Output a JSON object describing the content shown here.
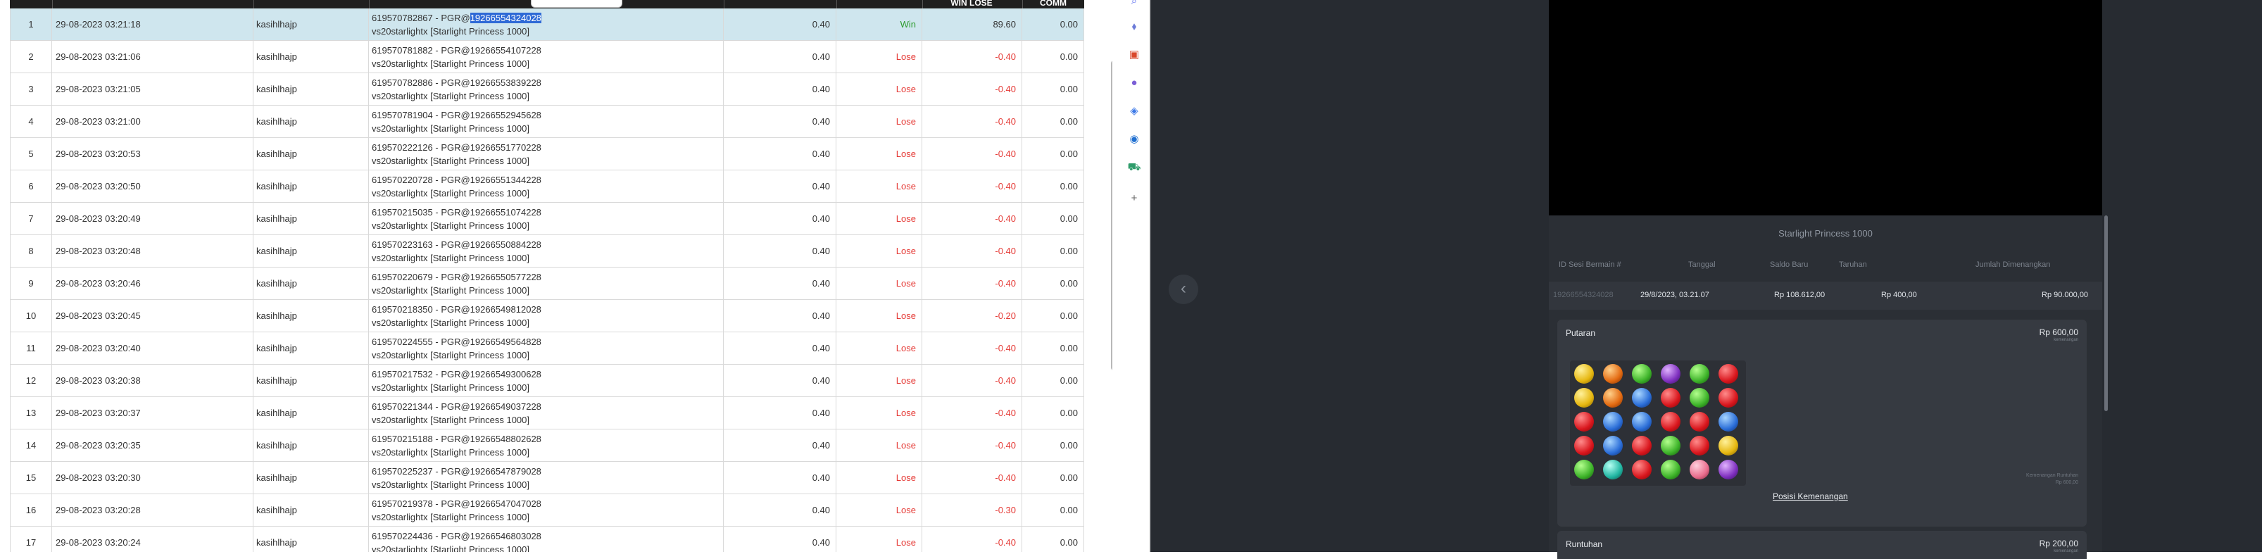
{
  "table": {
    "header": {
      "winlose": "WIN LOSE",
      "comm": "COMM"
    },
    "rows": [
      {
        "no": "1",
        "date": "29-08-2023 03:21:18",
        "user": "kasihlhajp",
        "ref_a": "619570782867 - PGR@",
        "ref_sel": "19266554324028",
        "line2": "vs20starlightx [Starlight Princess 1000]",
        "bet": "0.40",
        "status": "Win",
        "winlose": "89.60",
        "comm": "0.00"
      },
      {
        "no": "2",
        "date": "29-08-2023 03:21:06",
        "user": "kasihlhajp",
        "ref_a": "619570781882 - PGR@19266554107228",
        "ref_sel": "",
        "line2": "vs20starlightx [Starlight Princess 1000]",
        "bet": "0.40",
        "status": "Lose",
        "winlose": "-0.40",
        "comm": "0.00"
      },
      {
        "no": "3",
        "date": "29-08-2023 03:21:05",
        "user": "kasihlhajp",
        "ref_a": "619570782886 - PGR@19266553839228",
        "ref_sel": "",
        "line2": "vs20starlightx [Starlight Princess 1000]",
        "bet": "0.40",
        "status": "Lose",
        "winlose": "-0.40",
        "comm": "0.00"
      },
      {
        "no": "4",
        "date": "29-08-2023 03:21:00",
        "user": "kasihlhajp",
        "ref_a": "619570781904 - PGR@19266552945628",
        "ref_sel": "",
        "line2": "vs20starlightx [Starlight Princess 1000]",
        "bet": "0.40",
        "status": "Lose",
        "winlose": "-0.40",
        "comm": "0.00"
      },
      {
        "no": "5",
        "date": "29-08-2023 03:20:53",
        "user": "kasihlhajp",
        "ref_a": "619570222126 - PGR@19266551770228",
        "ref_sel": "",
        "line2": "vs20starlightx [Starlight Princess 1000]",
        "bet": "0.40",
        "status": "Lose",
        "winlose": "-0.40",
        "comm": "0.00"
      },
      {
        "no": "6",
        "date": "29-08-2023 03:20:50",
        "user": "kasihlhajp",
        "ref_a": "619570220728 - PGR@19266551344228",
        "ref_sel": "",
        "line2": "vs20starlightx [Starlight Princess 1000]",
        "bet": "0.40",
        "status": "Lose",
        "winlose": "-0.40",
        "comm": "0.00"
      },
      {
        "no": "7",
        "date": "29-08-2023 03:20:49",
        "user": "kasihlhajp",
        "ref_a": "619570215035 - PGR@19266551074228",
        "ref_sel": "",
        "line2": "vs20starlightx [Starlight Princess 1000]",
        "bet": "0.40",
        "status": "Lose",
        "winlose": "-0.40",
        "comm": "0.00"
      },
      {
        "no": "8",
        "date": "29-08-2023 03:20:48",
        "user": "kasihlhajp",
        "ref_a": "619570223163 - PGR@19266550884228",
        "ref_sel": "",
        "line2": "vs20starlightx [Starlight Princess 1000]",
        "bet": "0.40",
        "status": "Lose",
        "winlose": "-0.40",
        "comm": "0.00"
      },
      {
        "no": "9",
        "date": "29-08-2023 03:20:46",
        "user": "kasihlhajp",
        "ref_a": "619570220679 - PGR@19266550577228",
        "ref_sel": "",
        "line2": "vs20starlightx [Starlight Princess 1000]",
        "bet": "0.40",
        "status": "Lose",
        "winlose": "-0.40",
        "comm": "0.00"
      },
      {
        "no": "10",
        "date": "29-08-2023 03:20:45",
        "user": "kasihlhajp",
        "ref_a": "619570218350 - PGR@19266549812028",
        "ref_sel": "",
        "line2": "vs20starlightx [Starlight Princess 1000]",
        "bet": "0.40",
        "status": "Lose",
        "winlose": "-0.20",
        "comm": "0.00"
      },
      {
        "no": "11",
        "date": "29-08-2023 03:20:40",
        "user": "kasihlhajp",
        "ref_a": "619570224555 - PGR@19266549564828",
        "ref_sel": "",
        "line2": "vs20starlightx [Starlight Princess 1000]",
        "bet": "0.40",
        "status": "Lose",
        "winlose": "-0.40",
        "comm": "0.00"
      },
      {
        "no": "12",
        "date": "29-08-2023 03:20:38",
        "user": "kasihlhajp",
        "ref_a": "619570217532 - PGR@19266549300628",
        "ref_sel": "",
        "line2": "vs20starlightx [Starlight Princess 1000]",
        "bet": "0.40",
        "status": "Lose",
        "winlose": "-0.40",
        "comm": "0.00"
      },
      {
        "no": "13",
        "date": "29-08-2023 03:20:37",
        "user": "kasihlhajp",
        "ref_a": "619570221344 - PGR@19266549037228",
        "ref_sel": "",
        "line2": "vs20starlightx [Starlight Princess 1000]",
        "bet": "0.40",
        "status": "Lose",
        "winlose": "-0.40",
        "comm": "0.00"
      },
      {
        "no": "14",
        "date": "29-08-2023 03:20:35",
        "user": "kasihlhajp",
        "ref_a": "619570215188 - PGR@19266548802628",
        "ref_sel": "",
        "line2": "vs20starlightx [Starlight Princess 1000]",
        "bet": "0.40",
        "status": "Lose",
        "winlose": "-0.40",
        "comm": "0.00"
      },
      {
        "no": "15",
        "date": "29-08-2023 03:20:30",
        "user": "kasihlhajp",
        "ref_a": "619570225237 - PGR@19266547879028",
        "ref_sel": "",
        "line2": "vs20starlightx [Starlight Princess 1000]",
        "bet": "0.40",
        "status": "Lose",
        "winlose": "-0.40",
        "comm": "0.00"
      },
      {
        "no": "16",
        "date": "29-08-2023 03:20:28",
        "user": "kasihlhajp",
        "ref_a": "619570219378 - PGR@19266547047028",
        "ref_sel": "",
        "line2": "vs20starlightx [Starlight Princess 1000]",
        "bet": "0.40",
        "status": "Lose",
        "winlose": "-0.30",
        "comm": "0.00"
      },
      {
        "no": "17",
        "date": "29-08-2023 03:20:24",
        "user": "kasihlhajp",
        "ref_a": "619570224436 - PGR@19266546803028",
        "ref_sel": "",
        "line2": "vs20starlightx [Starlight Princess 1000]",
        "bet": "0.40",
        "status": "Lose",
        "winlose": "-0.40",
        "comm": "0.00"
      }
    ]
  },
  "sidebar": {
    "icons": [
      "search-icon",
      "tag-icon",
      "toolbox-icon",
      "people-icon",
      "puzzle-icon",
      "outlook-icon",
      "cart-icon",
      "plus-icon"
    ],
    "glyphs": [
      "⌕",
      "⬧",
      "▣",
      "●",
      "◈",
      "◉",
      "⛟",
      "+"
    ]
  },
  "game": {
    "back_glyph": "‹",
    "title": "Starlight Princess 1000",
    "columns": {
      "id": "ID Sesi Bermain #",
      "date": "Tanggal",
      "balance": "Saldo Baru",
      "bet": "Taruhan",
      "win": "Jumlah Dimenangkan"
    },
    "summary": {
      "id": "19266554324028",
      "date": "29/8/2023, 03.21.07",
      "balance": "Rp 108.612,00",
      "bet": "Rp 400,00",
      "win": "Rp 90.000,00"
    },
    "putaran": {
      "title": "Putaran",
      "amount": "Rp 600,00",
      "amount_sub": "kemenangan",
      "mini1": "Kemenangan Runtuhan",
      "mini2": "Rp 600,00"
    },
    "board": [
      [
        "yel",
        "org",
        "grn",
        "pur",
        "grn",
        "red"
      ],
      [
        "yel",
        "org",
        "blu",
        "red",
        "grn",
        "red"
      ],
      [
        "red",
        "blu",
        "blu",
        "red",
        "red",
        "blu"
      ],
      [
        "red",
        "blu",
        "red",
        "grn",
        "red",
        "yel"
      ],
      [
        "grn",
        "cyn",
        "red",
        "grn",
        "pnk",
        "pur"
      ]
    ],
    "posisi_link": "Posisi Kemenangan",
    "runtuhan": {
      "title": "Runtuhan",
      "amount": "Rp 200,00",
      "amount_sub": "kemenangan"
    }
  }
}
